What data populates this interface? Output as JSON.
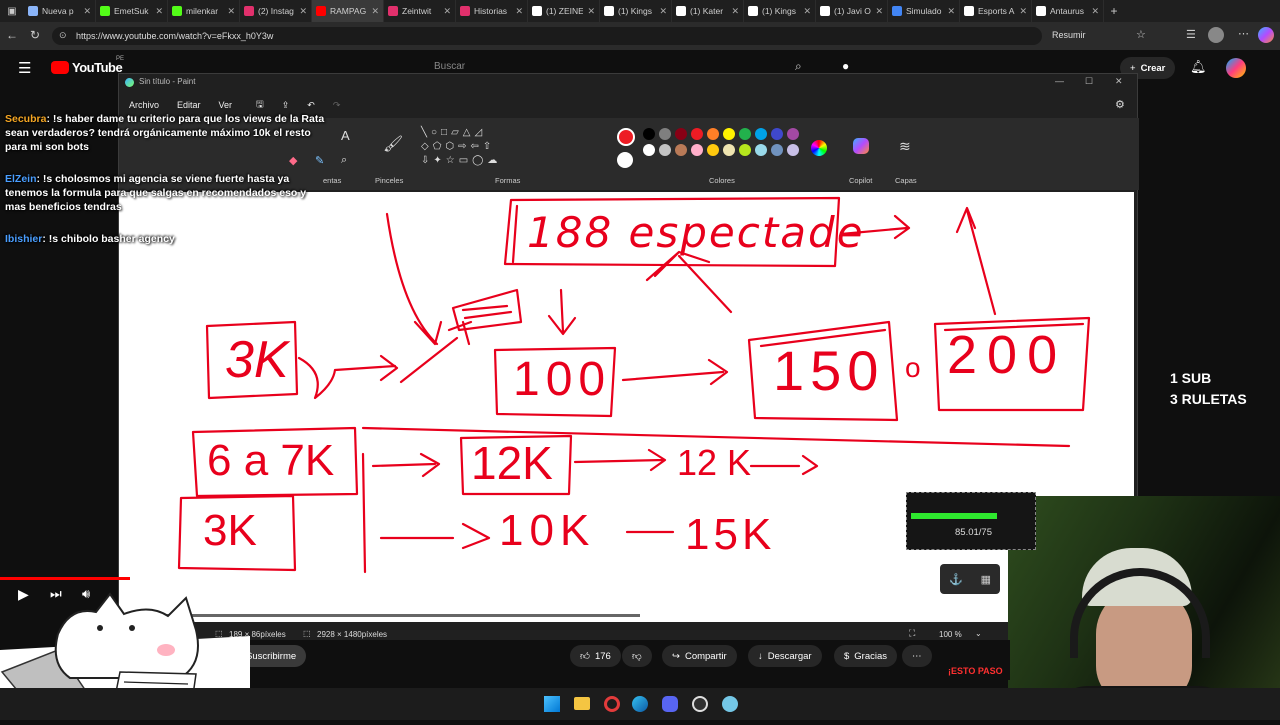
{
  "browser": {
    "tabs": [
      {
        "label": "Nueva p",
        "color": "#8ab4f8"
      },
      {
        "label": "EmetSuk",
        "color": "#53fc18"
      },
      {
        "label": "milenkar",
        "color": "#53fc18"
      },
      {
        "label": "(2) Instag",
        "color": "#e1306c"
      },
      {
        "label": "RAMPAG",
        "color": "#ff0000",
        "active": true
      },
      {
        "label": "Zeintwit",
        "color": "#e1306c"
      },
      {
        "label": "Historias",
        "color": "#e1306c"
      },
      {
        "label": "(1) ZEINE",
        "color": "#ffffff"
      },
      {
        "label": "(1) Kings",
        "color": "#ffffff"
      },
      {
        "label": "(1) Kater",
        "color": "#ffffff"
      },
      {
        "label": "(1) Kings",
        "color": "#ffffff"
      },
      {
        "label": "(1) Javi O",
        "color": "#ffffff"
      },
      {
        "label": "Simulado",
        "color": "#4285f4"
      },
      {
        "label": "Esports A",
        "color": "#ffffff"
      },
      {
        "label": "Antaurus",
        "color": "#ffffff"
      }
    ],
    "url": "https://www.youtube.com/watch?v=eFkxx_h0Y3w",
    "profile_label": "Resumir"
  },
  "youtube": {
    "logo": "YouTube",
    "region": "PE",
    "search_placeholder": "Buscar",
    "create_label": "Crear",
    "subscribe_label": "Suscribirme",
    "prev_label": "irme",
    "likes": "176",
    "share_label": "Compartir",
    "download_label": "Descargar",
    "thanks_label": "Gracias"
  },
  "paint": {
    "title": "Sin título - Paint",
    "menu": [
      "Archivo",
      "Editar",
      "Ver"
    ],
    "groups": {
      "tools": "entas",
      "brushes": "Pinceles",
      "shapes": "Formas",
      "colors": "Colores",
      "copilot": "Copilot",
      "layers": "Capas"
    },
    "palette_row1": [
      "#000000",
      "#7f7f7f",
      "#880015",
      "#ed1c24",
      "#ff7f27",
      "#fff200",
      "#22b14c",
      "#00a2e8",
      "#3f48cc",
      "#a349a4"
    ],
    "palette_row2": [
      "#ffffff",
      "#c3c3c3",
      "#b97a57",
      "#ffaec9",
      "#ffc90e",
      "#efe4b0",
      "#b5e61d",
      "#99d9ea",
      "#7092be",
      "#c8bfe7"
    ],
    "active_color": "#ed1c24",
    "status_selection": "189 × 86píxeles",
    "status_size": "2928 × 1480píxeles",
    "zoom": "100 %"
  },
  "drawing": {
    "ink": "#e8001c",
    "top_box": "188 espectade",
    "box_3k": "3K",
    "box_100": "100",
    "box_150": "150",
    "box_200": "200",
    "sep_o": "o",
    "box_6a7k": "6 a 7K",
    "box_12k": "12K",
    "text_12k": "12 K",
    "box_3k_b": "3K",
    "text_10k": "10K",
    "text_15k": "15K"
  },
  "chat": [
    {
      "user": "Secubra",
      "color": "#f5a623",
      "text": ": !s haber dame tu criterio para que los views de la Rata sean verdaderos? tendrá orgánicamente máximo 10k el resto para mi son bots"
    },
    {
      "user": "ElZein",
      "color": "#4a9eff",
      "text": ": !s cholosmos mi agencia se viene fuerte hasta ya tenemos la formula para que salgas en recomendados eso y mas beneficios tendras"
    },
    {
      "user": "Ibishier",
      "color": "#4a9eff",
      "text": ": !s chibolo basher agency"
    }
  ],
  "overlay": {
    "sub_line1": "1 SUB",
    "sub_line2": "3 RULETAS",
    "goal_text": "85.01/75",
    "goal_progress": 1.0,
    "goal_color": "#2ee82e",
    "banner": "¡ESTO PASO"
  }
}
